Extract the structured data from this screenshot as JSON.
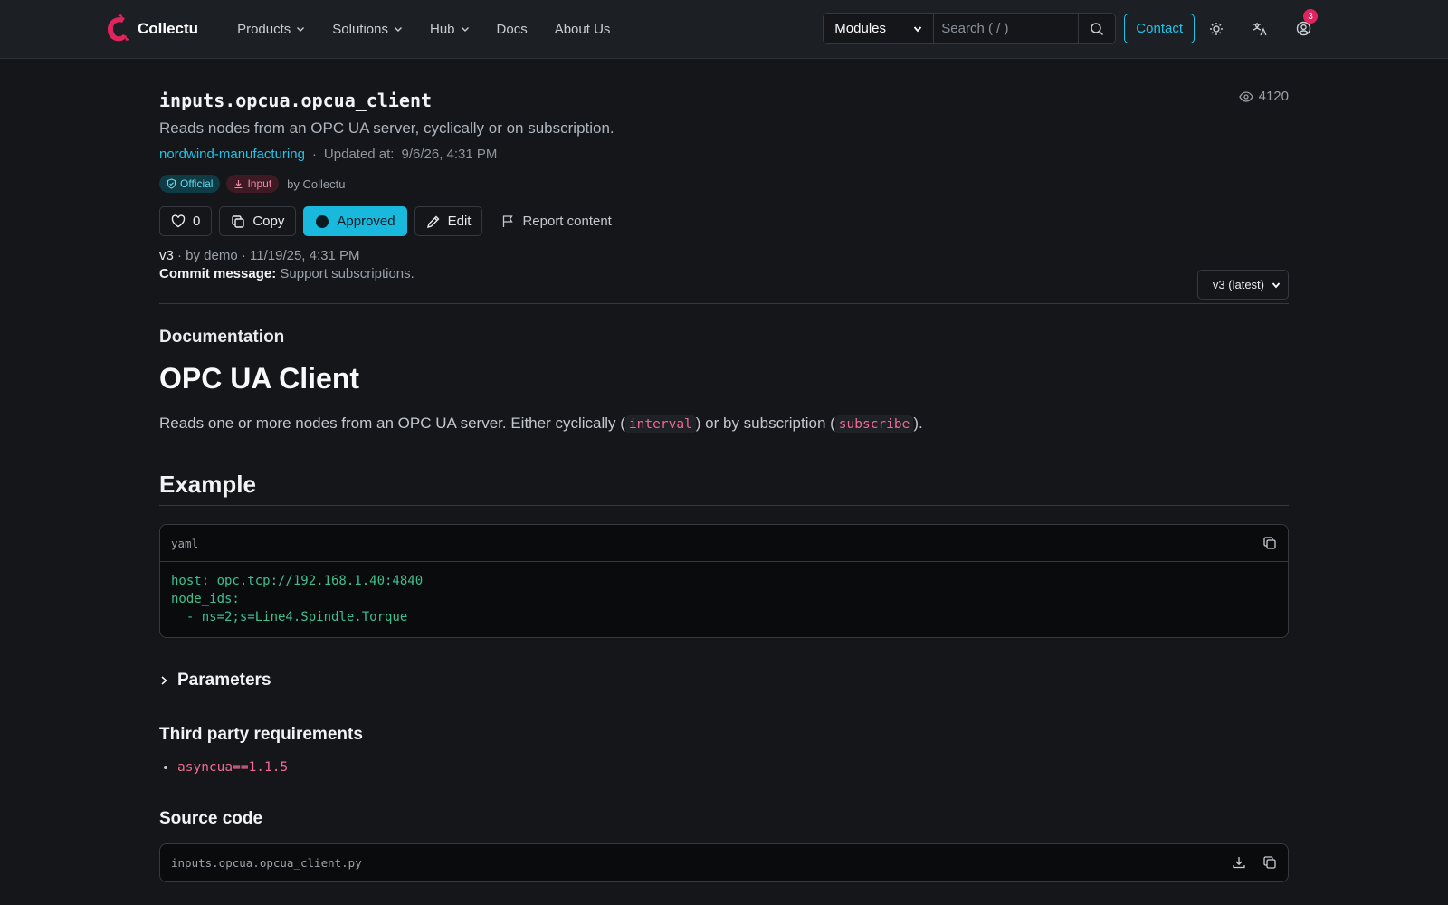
{
  "navbar": {
    "brand": "Collectu",
    "links": [
      "Products",
      "Solutions",
      "Hub",
      "Docs",
      "About Us"
    ],
    "search_scope": "Modules",
    "search_placeholder": "Search ( / )",
    "contact": "Contact",
    "notifications": "3"
  },
  "module": {
    "name": "inputs.opcua.opcua_client",
    "description": "Reads nodes from an OPC UA server, cyclically or on subscription.",
    "organization": "nordwind-manufacturing",
    "updated_label": "Updated at:",
    "updated_at": "9/6/26, 4:31 PM",
    "views": "4120",
    "badges": {
      "official": "Official",
      "input": "Input"
    },
    "author": "by Collectu"
  },
  "actions": {
    "likes": "0",
    "copy": "Copy",
    "approved": "Approved",
    "edit": "Edit",
    "report": "Report content",
    "version_select": "v3 (latest)"
  },
  "version": {
    "tag": "v3",
    "details": " · by demo · 11/19/25, 4:31 PM",
    "commit_label": "Commit message:",
    "commit_message": " Support subscriptions."
  },
  "documentation": {
    "heading": "Documentation",
    "title": "OPC UA Client",
    "intro_pre": "Reads one or more nodes from an OPC UA server. Either cyclically (",
    "intro_code1": "interval",
    "intro_mid": ") or by subscription (",
    "intro_code2": "subscribe",
    "intro_post": ").",
    "example_heading": "Example",
    "example_lang": "yaml",
    "example_code": "host: opc.tcp://192.168.1.40:4840\nnode_ids:\n  - ns=2;s=Line4.Spindle.Torque",
    "parameters": "Parameters",
    "requirements_heading": "Third party requirements",
    "requirements": [
      "asyncua==1.1.5"
    ],
    "source_heading": "Source code",
    "source_file": "inputs.opcua.opcua_client.py"
  },
  "colors": {
    "accent": "#19b8dd",
    "brand": "#e0245e",
    "code_green": "#3fbf8e",
    "code_pink": "#f06a91"
  }
}
